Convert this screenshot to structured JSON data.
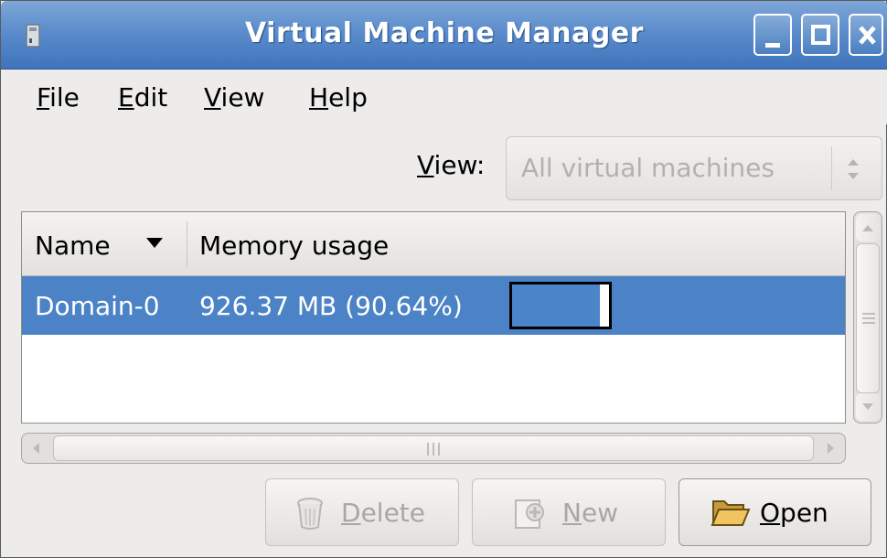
{
  "window": {
    "title": "Virtual Machine Manager"
  },
  "menubar": {
    "items": [
      {
        "label": "File",
        "mnemonic": "F",
        "rest": "ile"
      },
      {
        "label": "Edit",
        "mnemonic": "E",
        "rest": "dit"
      },
      {
        "label": "View",
        "mnemonic": "V",
        "rest": "iew"
      },
      {
        "label": "Help",
        "mnemonic": "H",
        "rest": "elp"
      }
    ]
  },
  "view_selector": {
    "label_mnemonic": "V",
    "label_rest": "iew:",
    "selected": "All virtual machines"
  },
  "table": {
    "columns": [
      {
        "label": "Name",
        "sorted": "descending"
      },
      {
        "label": "Memory usage"
      }
    ],
    "rows": [
      {
        "name": "Domain-0",
        "memory": "926.37 MB (90.64%)",
        "memory_fraction": 0.9064,
        "selected": true
      }
    ]
  },
  "buttons": {
    "delete": {
      "mnemonic": "D",
      "rest": "elete",
      "enabled": false,
      "icon": "trash-icon"
    },
    "new": {
      "mnemonic": "N",
      "rest": "ew",
      "enabled": false,
      "icon": "new-vm-icon"
    },
    "open": {
      "mnemonic": "O",
      "rest": "pen",
      "enabled": true,
      "icon": "folder-open-icon"
    }
  },
  "colors": {
    "selection": "#4b83c6",
    "titlebar": "#5b8ccc"
  }
}
